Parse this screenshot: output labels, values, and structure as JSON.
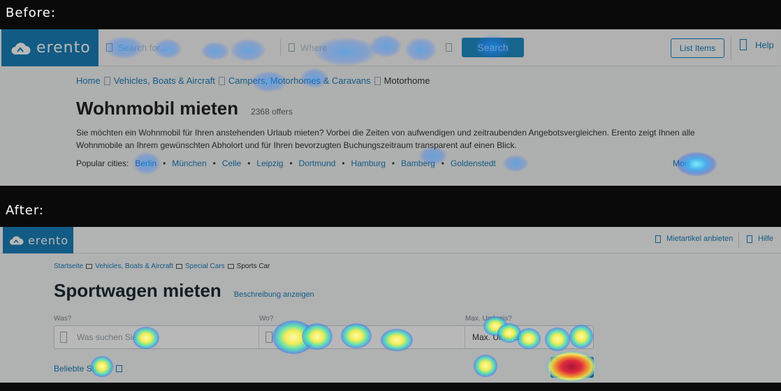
{
  "labels": {
    "before": "Before:",
    "after": "After:"
  },
  "before": {
    "logo_text": "erento",
    "search_placeholder": "Search for...",
    "where_placeholder": "Where",
    "search_button": "Search",
    "list_items_button": "List Items",
    "help_link": "Help",
    "breadcrumb": [
      "Home",
      "Vehicles, Boats & Aircraft",
      "Campers, Motorhomes & Caravans",
      "Motorhome"
    ],
    "title": "Wohnmobil mieten",
    "offers": "2368 offers",
    "description": "Sie möchten ein Wohnmobil für Ihren anstehenden Urlaub mieten? Vorbei die Zeiten von aufwendigen und zeitraubenden Angebotsvergleichen. Erento zeigt Ihnen alle Wohnmobile an Ihrem gewünschten Abholort und für Ihren bevorzugten Buchungszeitraum transparent auf einen Blick.",
    "popular_label": "Popular cities:",
    "cities": [
      "Berlin",
      "München",
      "Celle",
      "Leipzig",
      "Dortmund",
      "Hamburg",
      "Bamberg",
      "Goldenstedt"
    ],
    "more_link": "More"
  },
  "after": {
    "logo_text": "erento",
    "nav_list": "Mietartikel anbieten",
    "nav_help": "Hilfe",
    "breadcrumb": [
      "Startseite",
      "Vehicles, Boats & Aircraft",
      "Special Cars",
      "Sports Car"
    ],
    "title": "Sportwagen mieten",
    "show_description": "Beschreibung anzeigen",
    "label_what": "Was?",
    "label_where": "Wo?",
    "label_radius": "Max. Umkreis?",
    "what_placeholder": "Was suchen Sie?",
    "radius_value": "Max. Umkreis",
    "popular_label": "Beliebte Städte"
  }
}
